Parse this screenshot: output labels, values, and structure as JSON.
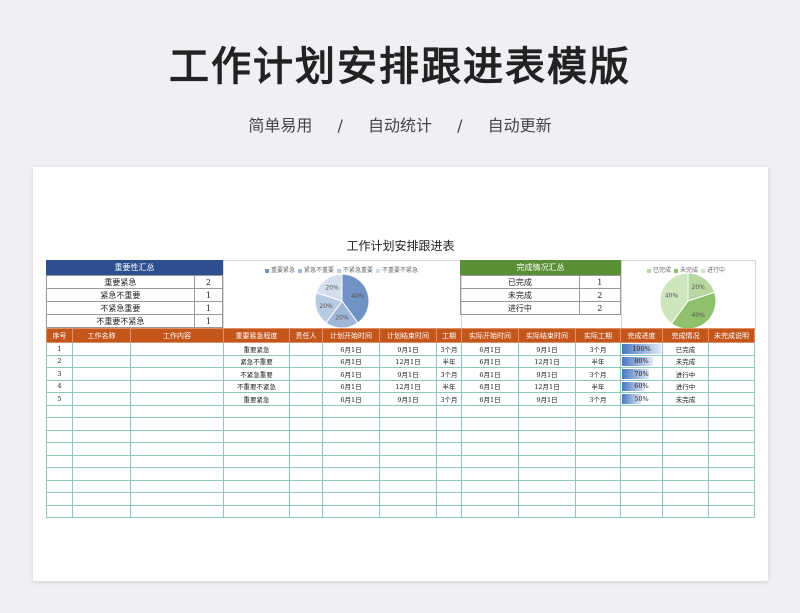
{
  "hero": {
    "title": "工作计划安排跟进表模版",
    "sub1": "简单易用",
    "sep1": "/",
    "sub2": "自动统计",
    "sep2": "/",
    "sub3": "自动更新"
  },
  "sheet": {
    "title": "工作计划安排跟进表"
  },
  "importance_summary": {
    "header": "重要性汇总",
    "header_color": "#2e4f8f",
    "rows": [
      {
        "label": "重要紧急",
        "value": "2"
      },
      {
        "label": "紧急不重要",
        "value": "1"
      },
      {
        "label": "不紧急重要",
        "value": "1"
      },
      {
        "label": "不重要不紧急",
        "value": "1"
      }
    ]
  },
  "importance_chart": {
    "legend": [
      "重要紧急",
      "紧急不重要",
      "不紧急重要",
      "不重要不紧急"
    ],
    "legend_colors": [
      "#6f93c4",
      "#9fb7d9",
      "#b9cbe3",
      "#d3dfee"
    ],
    "slices": [
      40,
      20,
      20,
      20
    ],
    "labels": [
      "40%",
      "20%",
      "20%",
      "20%"
    ]
  },
  "completion_summary": {
    "header": "完成情况汇总",
    "header_color": "#5a8f36",
    "rows": [
      {
        "label": "已完成",
        "value": "1"
      },
      {
        "label": "未完成",
        "value": "2"
      },
      {
        "label": "进行中",
        "value": "2"
      }
    ]
  },
  "completion_chart": {
    "legend": [
      "已完成",
      "未完成",
      "进行中"
    ],
    "legend_colors": [
      "#b7d7a0",
      "#8fc06b",
      "#cfe5bd"
    ],
    "slices": [
      20,
      40,
      40
    ],
    "labels": [
      "20%",
      "40%",
      "40%"
    ]
  },
  "table": {
    "header_color": "#c4561c",
    "headers": [
      "序号",
      "工作名称",
      "工作内容",
      "重要紧急程度",
      "责任人",
      "计划开始时间",
      "计划结束时间",
      "工期",
      "实际开始时间",
      "实际结束时间",
      "实际工期",
      "完成进度",
      "完成情况",
      "未完成说明"
    ],
    "rows": [
      [
        "1",
        "",
        "",
        "重要紧急",
        "",
        "6月1日",
        "9月1日",
        "3个月",
        "6月1日",
        "9月1日",
        "3个月",
        "100%",
        "已完成",
        ""
      ],
      [
        "2",
        "",
        "",
        "紧急不重要",
        "",
        "6月1日",
        "12月1日",
        "半年",
        "6月1日",
        "12月1日",
        "半年",
        "80%",
        "未完成",
        ""
      ],
      [
        "3",
        "",
        "",
        "不紧急重要",
        "",
        "6月1日",
        "9月1日",
        "3个月",
        "6月1日",
        "9月1日",
        "3个月",
        "70%",
        "进行中",
        ""
      ],
      [
        "4",
        "",
        "",
        "不重要不紧急",
        "",
        "6月1日",
        "12月1日",
        "半年",
        "6月1日",
        "12月1日",
        "半年",
        "60%",
        "进行中",
        ""
      ],
      [
        "5",
        "",
        "",
        "重要紧急",
        "",
        "6月1日",
        "9月1日",
        "3个月",
        "6月1日",
        "9月1日",
        "3个月",
        "50%",
        "未完成",
        ""
      ]
    ],
    "progress": [
      1.0,
      0.8,
      0.7,
      0.6,
      0.5
    ],
    "empty_rows": 9
  }
}
